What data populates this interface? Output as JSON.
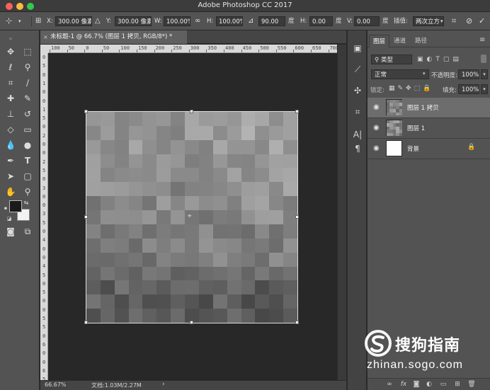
{
  "window": {
    "title": "Adobe Photoshop CC 2017"
  },
  "options_bar": {
    "x_label": "X:",
    "x_value": "300.00 像素",
    "y_label": "Y:",
    "y_value": "300.00 像素",
    "w_label": "W:",
    "w_value": "100.00%",
    "h_label": "H:",
    "h_value": "100.00%",
    "angle_value": "90.00",
    "angle_unit": "度",
    "hskew_label": "H:",
    "hskew_value": "0.00",
    "hskew_unit": "度",
    "vskew_label": "V:",
    "vskew_value": "0.00",
    "vskew_unit": "度",
    "interp_label": "插值:",
    "interp_value": "两次立方"
  },
  "document": {
    "tab_title": "未标题-1 @ 66.7% (图层 1 拷贝, RGB/8*) *",
    "zoom": "66.67%",
    "doc_size": "文档:1.03M/2.27M"
  },
  "ruler": {
    "h_ticks": [
      "100",
      "50",
      "0",
      "50",
      "100",
      "150",
      "200",
      "250",
      "300",
      "350",
      "400",
      "450",
      "500",
      "550",
      "600",
      "650",
      "700"
    ],
    "v_ticks": [
      "0",
      "5",
      "0",
      "1",
      "0",
      "0",
      "1",
      "5",
      "0",
      "2",
      "0",
      "0",
      "2",
      "5",
      "0",
      "3",
      "0",
      "0",
      "3",
      "5",
      "0",
      "4",
      "0",
      "0",
      "4",
      "5",
      "0",
      "5",
      "0",
      "0",
      "5",
      "5",
      "0",
      "6",
      "0",
      "0",
      "6",
      "5"
    ]
  },
  "layers_panel": {
    "tabs": [
      "图层",
      "通道",
      "路径"
    ],
    "filter_placeholder": "类型",
    "blend_mode": "正常",
    "opacity_label": "不透明度:",
    "opacity_value": "100%",
    "lock_label": "锁定:",
    "fill_label": "填充:",
    "fill_value": "100%",
    "layers": [
      {
        "name": "图层 1 拷贝",
        "selected": true,
        "locked": false
      },
      {
        "name": "图层 1",
        "selected": false,
        "locked": false
      },
      {
        "name": "背景",
        "selected": false,
        "locked": true
      }
    ]
  },
  "watermark": {
    "brand": "搜狗指南",
    "url": "zhinan.sogo.com"
  },
  "colors": {
    "foreground": "#1a1a1a",
    "background": "#f2f2f2",
    "accent": "#6d6d6d"
  }
}
